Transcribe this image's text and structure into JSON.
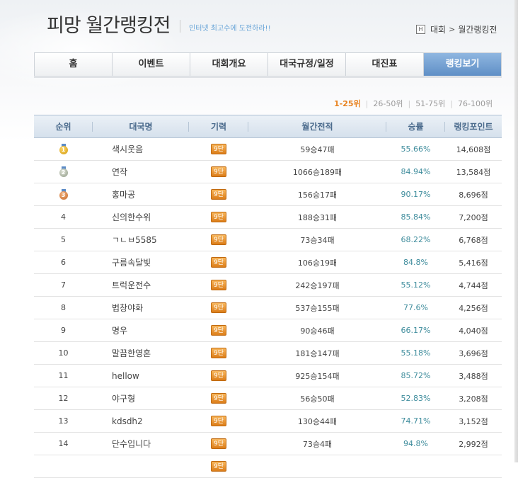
{
  "header": {
    "title": "피망 월간랭킹전",
    "subtitle": "인터넷 최고수에 도전하라!!",
    "breadcrumb": {
      "home_icon_label": "H",
      "section": "대회",
      "current": "월간랭킹전"
    }
  },
  "tabs": [
    {
      "label": "홈",
      "active": false
    },
    {
      "label": "이벤트",
      "active": false
    },
    {
      "label": "대회개요",
      "active": false
    },
    {
      "label": "대국규정/일정",
      "active": false
    },
    {
      "label": "대진표",
      "active": false
    },
    {
      "label": "랭킹보기",
      "active": true
    }
  ],
  "pager": {
    "pages": [
      "1-25위",
      "26-50위",
      "51-75위",
      "76-100위"
    ],
    "current_index": 0
  },
  "table": {
    "headers": [
      "순위",
      "대국명",
      "기력",
      "월간전적",
      "승률",
      "랭킹포인트"
    ],
    "rows": [
      {
        "rank": "1",
        "medal": "gold",
        "name": "색시웃음",
        "level": "9단",
        "record": "59승47패",
        "rate": "55.66%",
        "points": "14,608점"
      },
      {
        "rank": "2",
        "medal": "silver",
        "name": "연작",
        "level": "9단",
        "record": "1066승189패",
        "rate": "84.94%",
        "points": "13,584점"
      },
      {
        "rank": "3",
        "medal": "bronze",
        "name": "홍마공",
        "level": "9단",
        "record": "156승17패",
        "rate": "90.17%",
        "points": "8,696점"
      },
      {
        "rank": "4",
        "medal": null,
        "name": "신의한수위",
        "level": "9단",
        "record": "188승31패",
        "rate": "85.84%",
        "points": "7,200점"
      },
      {
        "rank": "5",
        "medal": null,
        "name": "ㄱㄴㅂ5585",
        "level": "9단",
        "record": "73승34패",
        "rate": "68.22%",
        "points": "6,768점"
      },
      {
        "rank": "6",
        "medal": null,
        "name": "구름속달빛",
        "level": "9단",
        "record": "106승19패",
        "rate": "84.8%",
        "points": "5,416점"
      },
      {
        "rank": "7",
        "medal": null,
        "name": "트럭운전수",
        "level": "9단",
        "record": "242승197패",
        "rate": "55.12%",
        "points": "4,744점"
      },
      {
        "rank": "8",
        "medal": null,
        "name": "법창야화",
        "level": "9단",
        "record": "537승155패",
        "rate": "77.6%",
        "points": "4,256점"
      },
      {
        "rank": "9",
        "medal": null,
        "name": "명우",
        "level": "9단",
        "record": "90승46패",
        "rate": "66.17%",
        "points": "4,040점"
      },
      {
        "rank": "10",
        "medal": null,
        "name": "말끔한영혼",
        "level": "9단",
        "record": "181승147패",
        "rate": "55.18%",
        "points": "3,696점"
      },
      {
        "rank": "11",
        "medal": null,
        "name": "hellow",
        "level": "9단",
        "record": "925승154패",
        "rate": "85.72%",
        "points": "3,488점"
      },
      {
        "rank": "12",
        "medal": null,
        "name": "야구형",
        "level": "9단",
        "record": "56승50패",
        "rate": "52.83%",
        "points": "3,208점"
      },
      {
        "rank": "13",
        "medal": null,
        "name": "kdsdh2",
        "level": "9단",
        "record": "130승44패",
        "rate": "74.71%",
        "points": "3,152점"
      },
      {
        "rank": "14",
        "medal": null,
        "name": "단수입니다",
        "level": "9단",
        "record": "73승4패",
        "rate": "94.8%",
        "points": "2,992점"
      },
      {
        "rank": "",
        "medal": null,
        "name": "",
        "level": "9단",
        "record": "",
        "rate": "",
        "points": ""
      }
    ]
  },
  "colors": {
    "accent_blue": "#5f8fc6",
    "pager_current": "#e8821e",
    "rate_text": "#3e8c9c",
    "level_badge": "#dc7e1a"
  }
}
